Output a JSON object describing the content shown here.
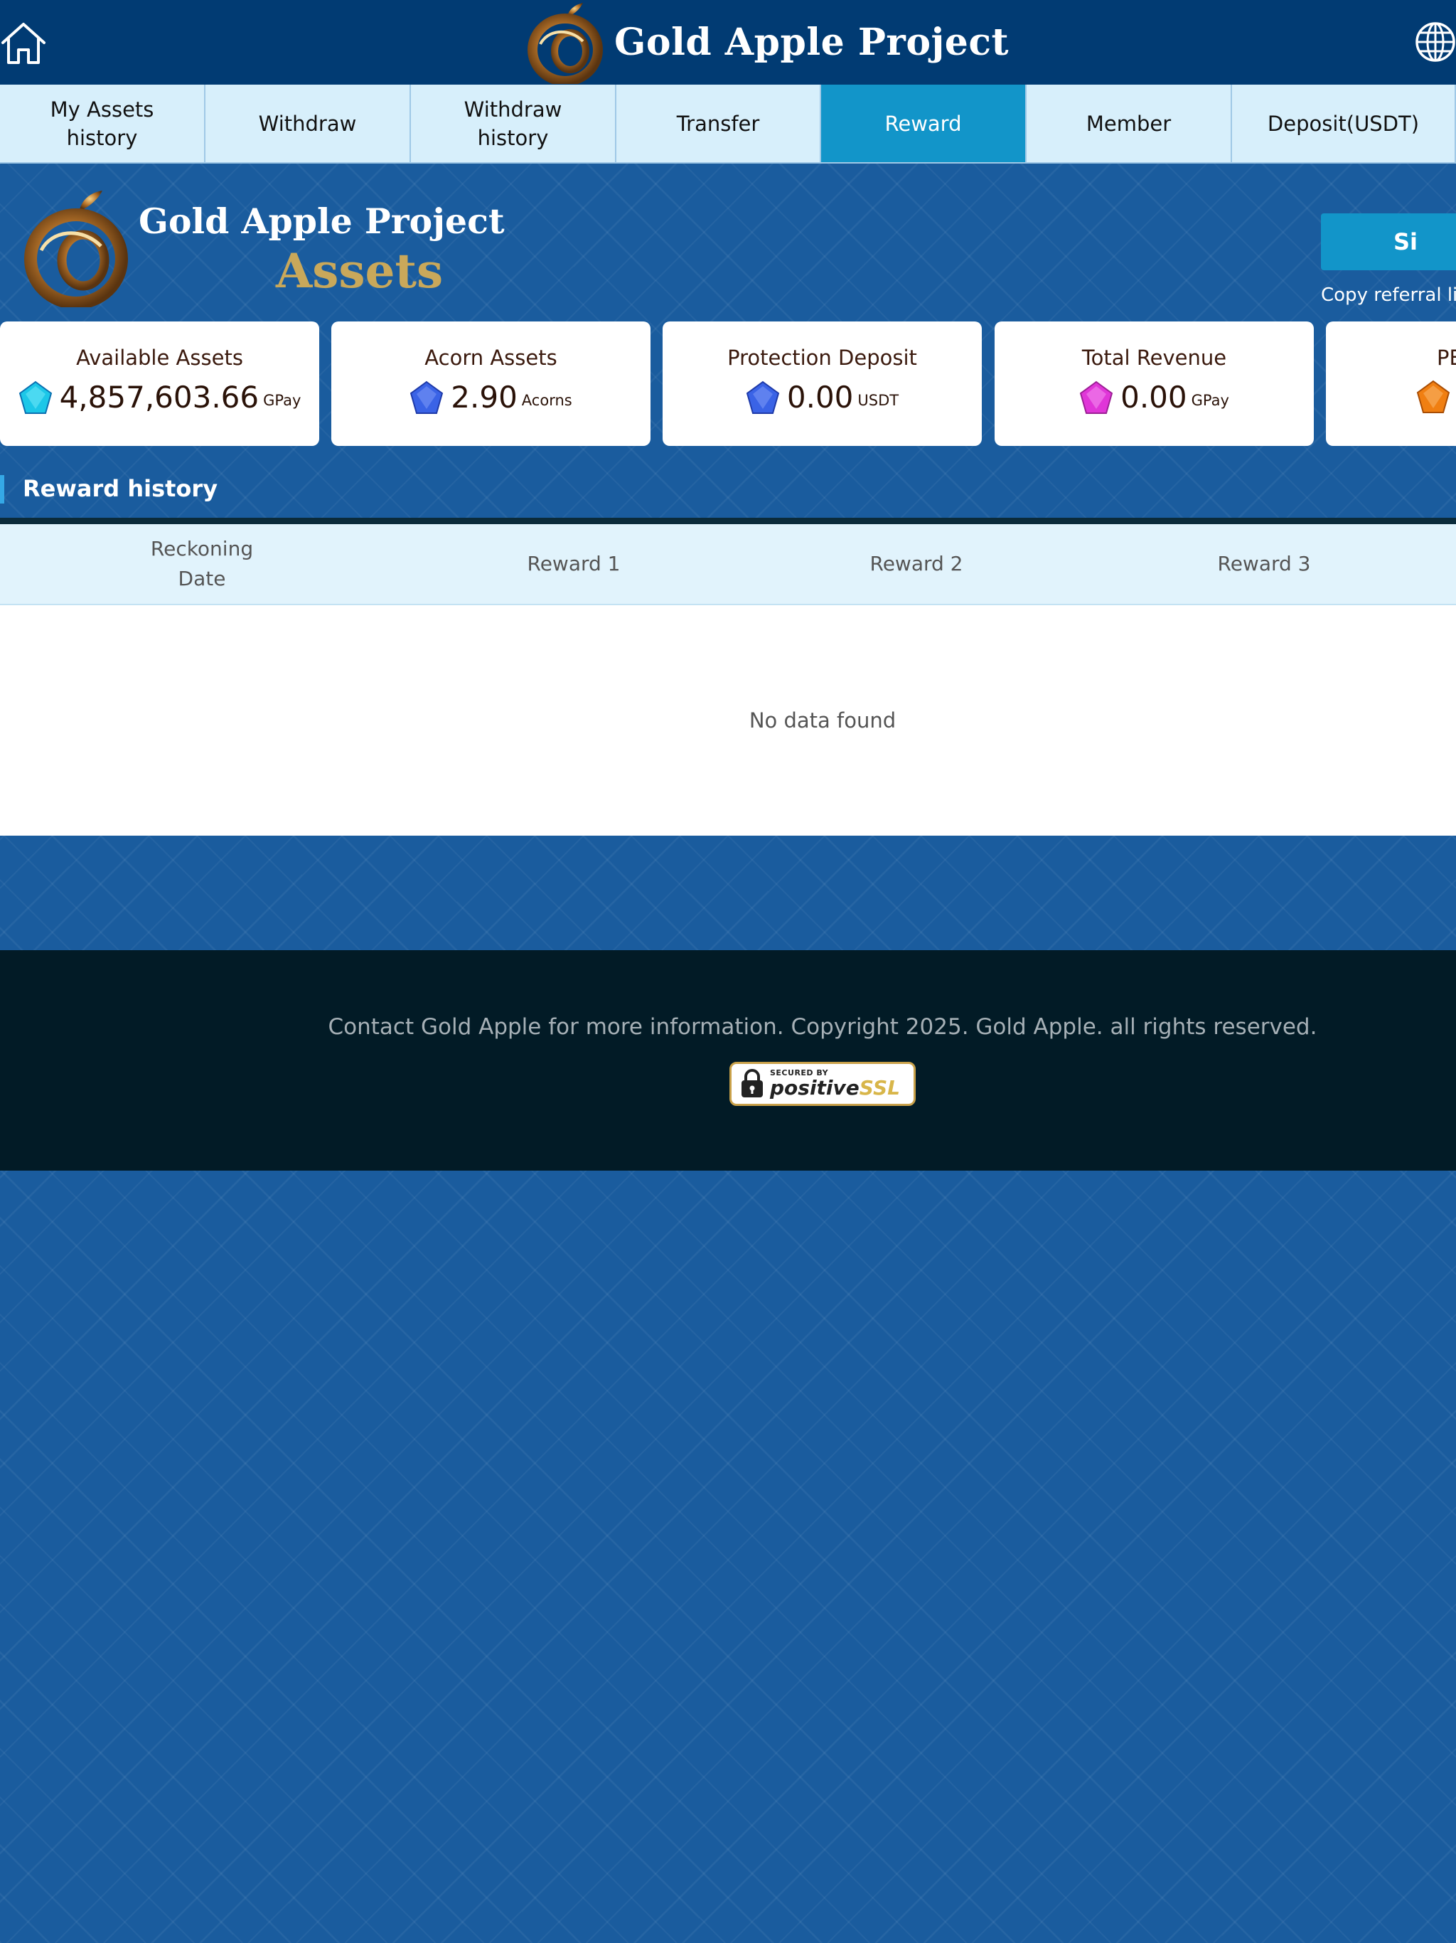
{
  "header": {
    "title": "Gold Apple Project"
  },
  "tabs": [
    {
      "label": "My Assets\nhistory",
      "active": false
    },
    {
      "label": "Withdraw",
      "active": false
    },
    {
      "label": "Withdraw\nhistory",
      "active": false
    },
    {
      "label": "Transfer",
      "active": false
    },
    {
      "label": "Reward",
      "active": true
    },
    {
      "label": "Member",
      "active": false
    },
    {
      "label": "Deposit(USDT)",
      "active": false
    }
  ],
  "hero": {
    "title": "Gold Apple Project",
    "subtitle": "Assets",
    "signin_label": "Si",
    "copy_link_label": "Copy referral lin"
  },
  "cards": [
    {
      "title": "Available Assets",
      "value": "4,857,603.66",
      "unit": "GPay",
      "gem_color": "#1cc7e8"
    },
    {
      "title": "Acorn Assets",
      "value": "2.90",
      "unit": "Acorns",
      "gem_color": "#3a63e6"
    },
    {
      "title": "Protection Deposit",
      "value": "0.00",
      "unit": "USDT",
      "gem_color": "#3a63e6"
    },
    {
      "title": "Total Revenue",
      "value": "0.00",
      "unit": "GPay",
      "gem_color": "#e036d8"
    },
    {
      "title": "PE",
      "value": "",
      "unit": "",
      "gem_color": "#f07f12"
    }
  ],
  "section": {
    "title": "Reward history"
  },
  "table": {
    "columns": [
      "Reckoning\nDate",
      "Reward 1",
      "Reward 2",
      "Reward 3"
    ],
    "empty_text": "No data found"
  },
  "footer": {
    "text": "Contact Gold Apple for more information. Copyright 2025. Gold Apple. all rights reserved.",
    "ssl_small": "SECURED BY",
    "ssl_main_a": "positive",
    "ssl_main_b": "SSL"
  },
  "colors": {
    "header_bg": "#013b73",
    "tab_bg": "#d7effb",
    "tab_active_bg": "#1295c9",
    "page_bg": "#1a5c9e",
    "footer_bg": "#021b26"
  }
}
